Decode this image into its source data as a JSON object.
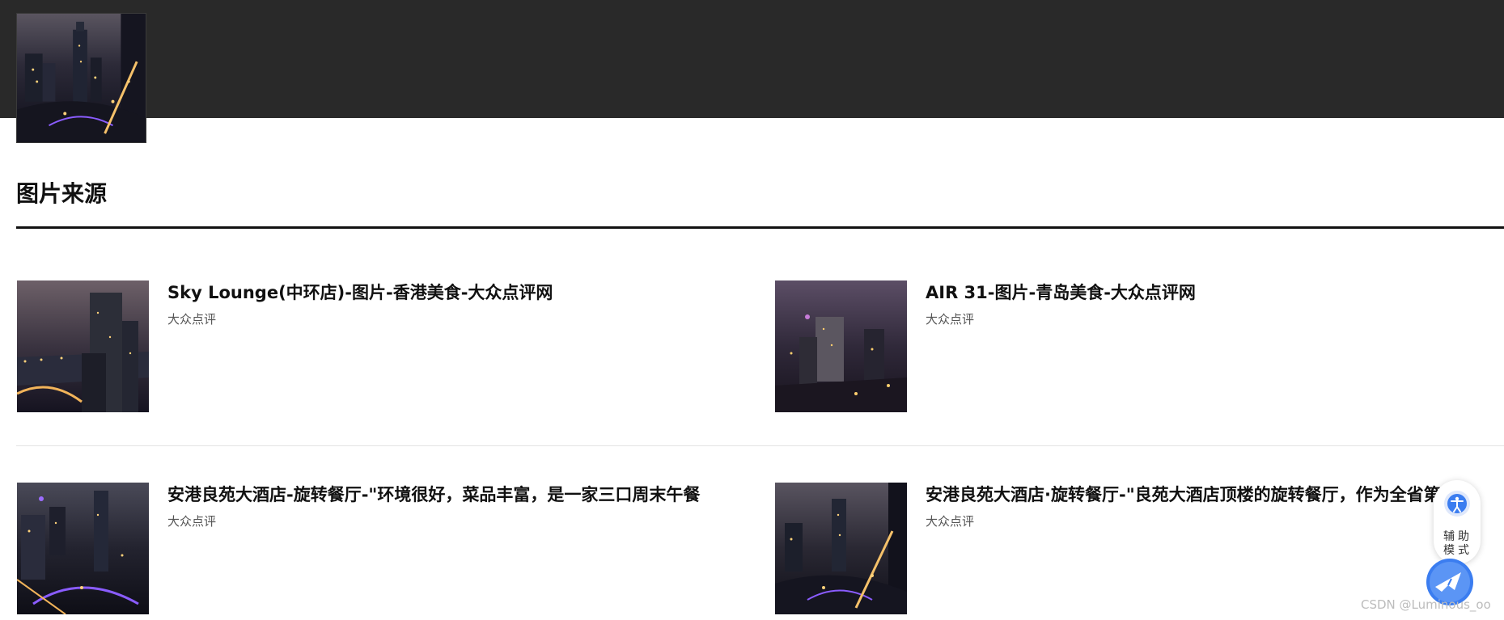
{
  "header": {
    "hero_image_icon": "city-night-thumbnail"
  },
  "section": {
    "title": "图片来源"
  },
  "results": [
    {
      "title": "Sky Lounge(中环店)-图片-香港美食-大众点评网",
      "source": "大众点评"
    },
    {
      "title": "AIR 31-图片-青岛美食-大众点评网",
      "source": "大众点评"
    },
    {
      "title": "安港良苑大酒店-旋转餐厅-\"环境很好，菜品丰富，是一家三口周末午餐",
      "source": "大众点评"
    },
    {
      "title": "安港良苑大酒店·旋转餐厅-\"良苑大酒店顶楼的旋转餐厅，作为全省第",
      "source": "大众点评"
    }
  ],
  "assist": {
    "label": "辅助模式",
    "icon": "accessibility-icon",
    "bird_icon": "bird-icon"
  },
  "watermark": "CSDN @Luminous_oo",
  "colors": {
    "topbar": "#292929",
    "rule": "#111111",
    "divider": "#e4e4e4",
    "assist_blue": "#3b7df0"
  }
}
